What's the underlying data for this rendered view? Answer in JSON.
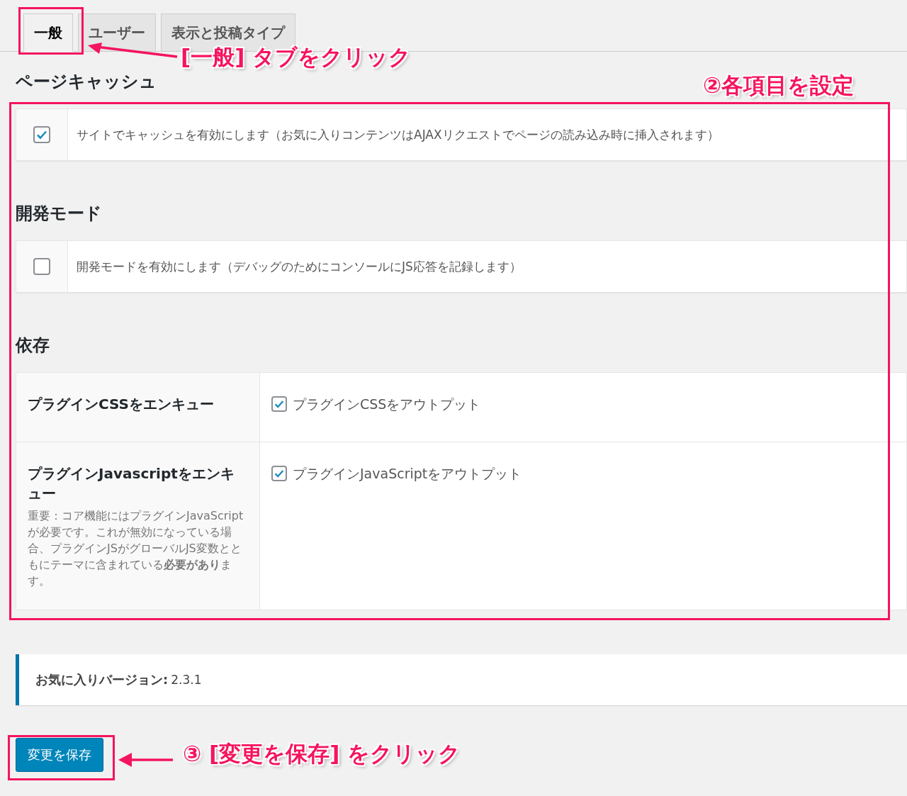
{
  "tabs": [
    {
      "label": "一般",
      "selected": true
    },
    {
      "label": "ユーザー",
      "selected": false
    },
    {
      "label": "表示と投稿タイプ",
      "selected": false
    }
  ],
  "sections": [
    {
      "heading": "ページキャッシュ",
      "kind": "checkbox_row",
      "checked": true,
      "label": "サイトでキャッシュを有効にします（お気に入りコンテンツはAJAXリクエストでページの読み込み時に挿入されます）"
    },
    {
      "heading": "開発モード",
      "kind": "checkbox_row",
      "checked": false,
      "label": "開発モードを有効にします（デバッグのためにコンソールにJS応答を記録します）"
    },
    {
      "heading": "依存",
      "kind": "table",
      "rows": [
        {
          "label": "プラグインCSSをエンキュー",
          "checked": true,
          "option": "プラグインCSSをアウトプット"
        },
        {
          "label": "プラグインJavascriptをエンキュー",
          "description": "重要：コア機能にはプラグインJavaScriptが必要です。これが無効になっている場合、プラグインJSがグローバルJS変数とともにテーマに含まれている**必要があり**ます。",
          "checked": true,
          "option": "プラグインJavaScriptをアウトプット"
        }
      ]
    }
  ],
  "version": {
    "label": "お気に入りバージョン:",
    "value": "2.3.1"
  },
  "save_button": "変更を保存",
  "annotations": [
    {
      "text": "[一般] タブをクリック"
    },
    {
      "text": "②各項目を設定"
    },
    {
      "text": "③ [変更を保存] をクリック"
    }
  ]
}
